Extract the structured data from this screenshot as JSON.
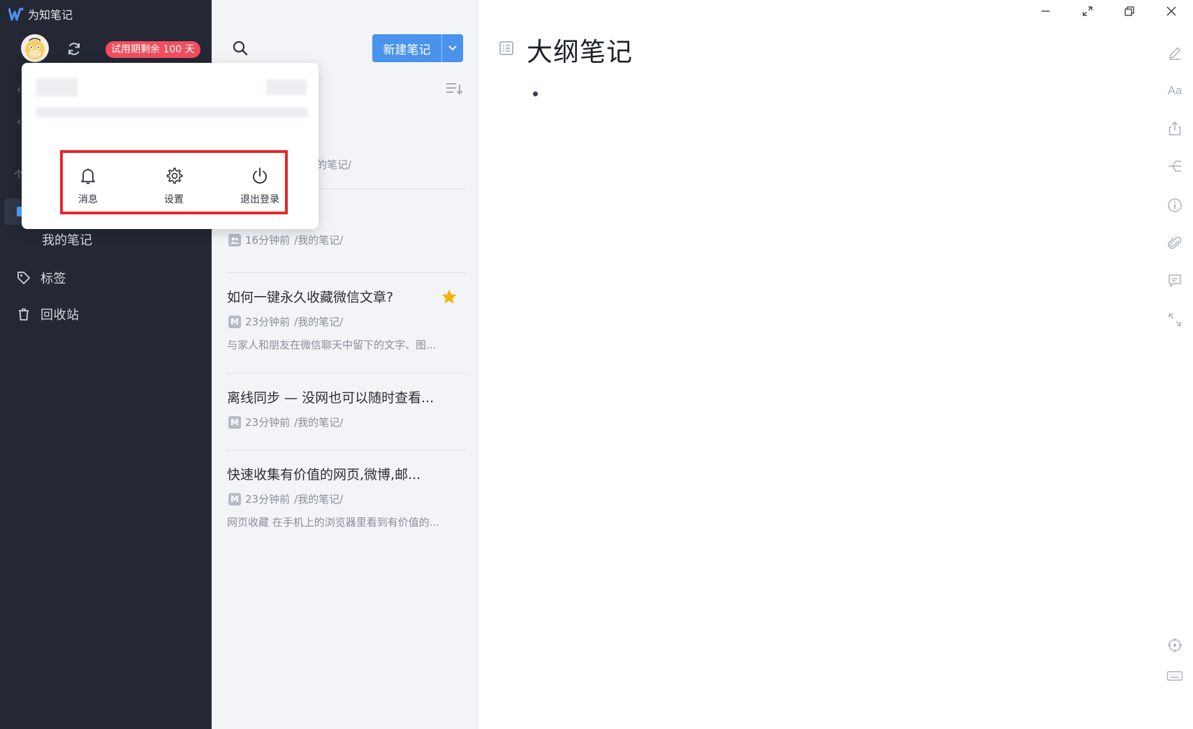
{
  "app": {
    "title": "为知笔记",
    "brand_color": "#4a93ec"
  },
  "sidebar": {
    "trial_badge": "试用期剩余 100 天",
    "trial_badge_color": "#f04e5e",
    "sub_item": "我的笔记",
    "items": [
      {
        "label": "标签",
        "icon": "tag-icon"
      },
      {
        "label": "回收站",
        "icon": "trash-icon"
      }
    ]
  },
  "popup": {
    "actions": [
      {
        "label": "消息",
        "icon": "bell-icon"
      },
      {
        "label": "设置",
        "icon": "gear-icon"
      },
      {
        "label": "退出登录",
        "icon": "power-icon"
      }
    ],
    "highlight_color": "#e8262a"
  },
  "list": {
    "new_note_label": "新建笔记",
    "partial_meta_top": "的笔记/",
    "notes": [
      {
        "title": "",
        "time": "16分钟前",
        "path": "/我的笔记/",
        "snippet": ""
      },
      {
        "title": "如何一键永久收藏微信文章?",
        "time": "23分钟前",
        "path": "/我的笔记/",
        "snippet": "与家人和朋友在微信聊天中留下的文字、图...",
        "starred": true
      },
      {
        "title": "离线同步 — 没网也可以随时查看...",
        "time": "23分钟前",
        "path": "/我的笔记/",
        "snippet": ""
      },
      {
        "title": "快速收集有价值的网页,微博,邮...",
        "time": "23分钟前",
        "path": "/我的笔记/",
        "snippet": "网页收藏 在手机上的浏览器里看到有价值的..."
      }
    ]
  },
  "editor": {
    "title": "大纲笔记",
    "toolbar": [
      "edit-icon",
      "font-icon",
      "share-icon",
      "outline-tree-icon",
      "info-icon",
      "attachment-icon",
      "comment-icon",
      "expand-icon"
    ],
    "font_tool_label": "Aa",
    "bottom_tools": [
      "locate-icon",
      "keyboard-icon"
    ]
  }
}
